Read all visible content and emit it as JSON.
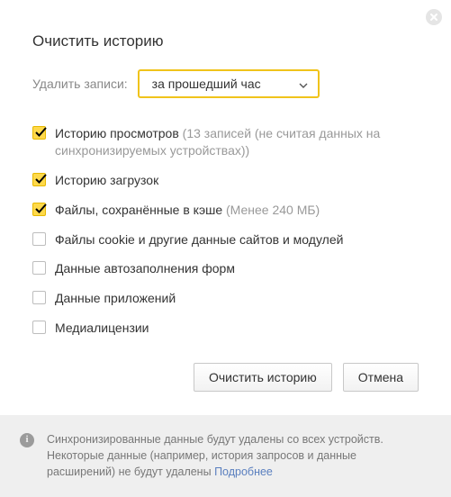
{
  "title": "Очистить историю",
  "period": {
    "label": "Удалить записи:",
    "selected": "за прошедший час"
  },
  "options": [
    {
      "checked": true,
      "label": "Историю просмотров",
      "hint": "(13 записей (не считая данных на синхронизируемых устройствах))"
    },
    {
      "checked": true,
      "label": "Историю загрузок",
      "hint": ""
    },
    {
      "checked": true,
      "label": "Файлы, сохранённые в кэше",
      "hint": "(Менее 240 МБ)"
    },
    {
      "checked": false,
      "label": "Файлы cookie и другие данные сайтов и модулей",
      "hint": ""
    },
    {
      "checked": false,
      "label": "Данные автозаполнения форм",
      "hint": ""
    },
    {
      "checked": false,
      "label": "Данные приложений",
      "hint": ""
    },
    {
      "checked": false,
      "label": "Медиалицензии",
      "hint": ""
    }
  ],
  "buttons": {
    "clear": "Очистить историю",
    "cancel": "Отмена"
  },
  "footer": {
    "text": "Синхронизированные данные будут удалены со всех устройств. Некоторые данные (например, история запросов и данные расширений) не будут удалены ",
    "link": "Подробнее"
  }
}
